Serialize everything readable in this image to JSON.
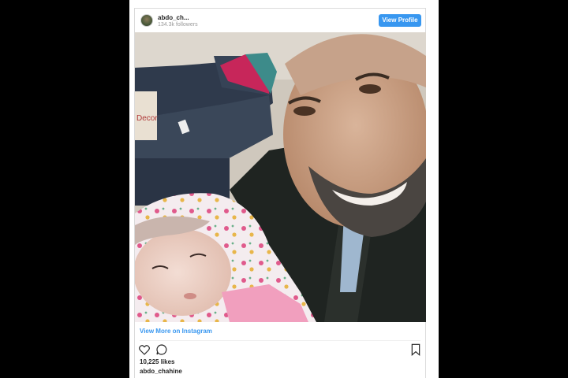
{
  "post": {
    "username": "abdo_ch...",
    "followers": "134.3k followers",
    "view_profile_label": "View Profile",
    "view_more_label": "View More on Instagram",
    "likes": "10,225 likes",
    "caption_author": "abdo_chahine"
  },
  "icons": {
    "like": "heart-icon",
    "comment": "speech-bubble-icon",
    "save": "bookmark-icon"
  },
  "colors": {
    "accent": "#3897f0",
    "text": "#262626",
    "muted": "#999999",
    "background": "#000000"
  }
}
